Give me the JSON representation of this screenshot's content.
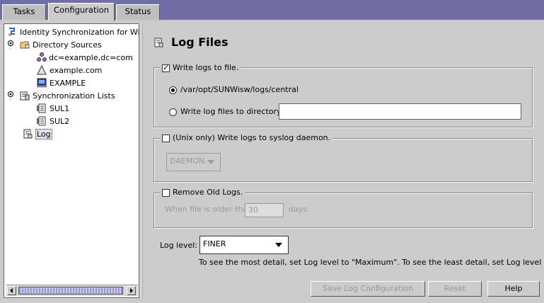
{
  "tabs": [
    {
      "label": "Tasks"
    },
    {
      "label": "Configuration"
    },
    {
      "label": "Status"
    }
  ],
  "tree": {
    "root": "Identity Synchronization for Windo",
    "directory_sources": "Directory Sources",
    "ds_items": [
      "dc=example,dc=com",
      "example.com",
      "EXAMPLE"
    ],
    "sync_lists": "Synchronization Lists",
    "sul_items": [
      "SUL1",
      "SUL2"
    ],
    "log": "Log"
  },
  "page": {
    "title": "Log Files",
    "write_logs_label": "Write logs to file.",
    "write_logs_checked": true,
    "default_path": "/var/opt/SUNWisw/logs/central",
    "dir_option_label": "Write log files to directory:",
    "dir_value": "",
    "syslog_label": "(Unix only) Write logs to syslog daemon.",
    "syslog_checked": false,
    "syslog_facility": "DAEMON",
    "remove_label": "Remove Old Logs.",
    "remove_checked": false,
    "older_than_label": "When file is older than",
    "days_value": "30",
    "days_label": "days.",
    "log_level_label": "Log level:",
    "log_level_value": "FINER",
    "hint": "To see the most detail, set Log level to \"Maximum\". To see the least detail, set Log level to"
  },
  "buttons": {
    "save": "Save Log Configuration",
    "reset": "Reset",
    "help": "Help"
  }
}
